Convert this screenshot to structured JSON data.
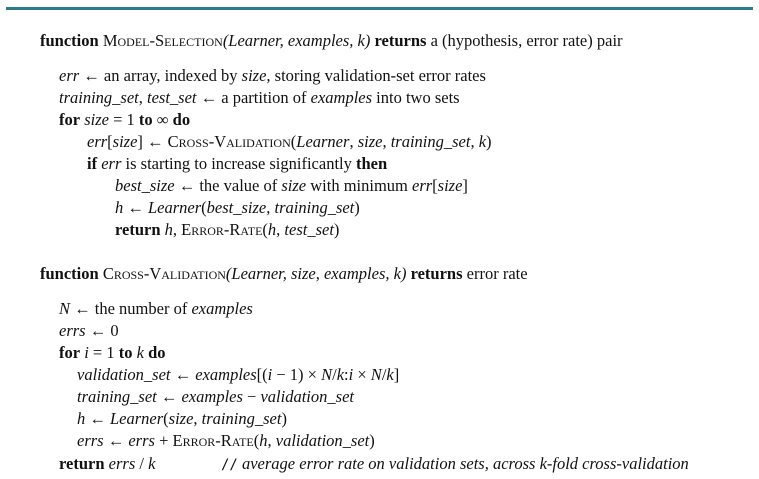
{
  "top_rule_color": "#2f7a8c",
  "model_selection": {
    "header": {
      "kw_function": "function",
      "name": "Model-Selection",
      "args": "(Learner, examples, k)",
      "kw_returns": "returns",
      "rest": "a (hypothesis, error rate) pair"
    },
    "body": [
      {
        "segments": [
          "err",
          " ← an array, indexed by ",
          "size",
          ", storing validation-set error rates"
        ]
      },
      {
        "segments": [
          "training_set",
          ",  ",
          "test_set",
          " ← a partition of ",
          "examples",
          " into two  sets"
        ]
      },
      {
        "segments": [
          "for",
          " ",
          "size",
          " = 1 ",
          "to",
          " ∞ ",
          "do"
        ]
      },
      {
        "segments": [
          "err",
          "[",
          "size",
          "] ← ",
          "Cross-Validation",
          "(",
          "Learner",
          ", ",
          "size",
          ", ",
          "training_set",
          ", ",
          "k",
          ")"
        ]
      },
      {
        "segments": [
          "if",
          " ",
          "err",
          " is starting to increase significantly ",
          "then"
        ]
      },
      {
        "segments": [
          "best_size",
          " ← the value of ",
          "size",
          " with minimum ",
          "err",
          "[",
          "size",
          "]"
        ]
      },
      {
        "segments": [
          "h",
          " ← ",
          "Learner",
          "(",
          "best_size",
          ", ",
          "training_set",
          ")"
        ]
      },
      {
        "segments": [
          "return",
          " ",
          "h",
          ",  ",
          "Error-Rate",
          "(",
          "h",
          ",  ",
          "test_set",
          ")"
        ]
      }
    ]
  },
  "cross_validation": {
    "header": {
      "kw_function": "function",
      "name": "Cross-Validation",
      "args": "(Learner, size, examples, k)",
      "kw_returns": "returns",
      "rest": "error rate"
    },
    "body": [
      {
        "segments": [
          "N",
          " ← the number of ",
          "examples"
        ]
      },
      {
        "segments": [
          "errs",
          " ← 0"
        ]
      },
      {
        "segments": [
          "for",
          " ",
          "i",
          " = 1 ",
          "to",
          " ",
          "k",
          " ",
          "do"
        ]
      },
      {
        "segments": [
          "validation_set",
          " ← ",
          "examples",
          "[(",
          "i",
          " − 1) × ",
          "N",
          "/",
          "k",
          ":",
          "i",
          " × ",
          "N",
          "/",
          "k",
          "]"
        ]
      },
      {
        "segments": [
          "training_set",
          " ← ",
          "examples",
          " − ",
          "validation_set"
        ]
      },
      {
        "segments": [
          "h",
          " ← ",
          "Learner",
          "(",
          "size",
          ", ",
          "training_set",
          ")"
        ]
      },
      {
        "segments": [
          "errs",
          " ← ",
          "errs",
          " + ",
          "Error-Rate",
          "(",
          "h",
          ", ",
          "validation_set",
          ")"
        ]
      },
      {
        "segments": [
          "return",
          " ",
          "errs",
          " / ",
          "k"
        ],
        "comment_slashes": "//",
        "comment": " average error rate on validation sets, across k-fold cross-validation"
      }
    ]
  }
}
